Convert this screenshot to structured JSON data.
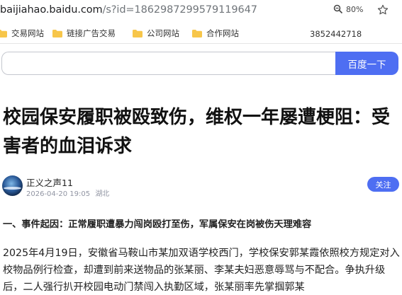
{
  "browser": {
    "url_host": "baijiahao.baidu.com",
    "url_path": "/s?id=1862987299579119647",
    "zoom": "80%"
  },
  "bookmarks": [
    {
      "label": "交易网站"
    },
    {
      "label": "链接广告交易"
    },
    {
      "label": "公司网站"
    },
    {
      "label": "合作网站"
    }
  ],
  "bookmark_extra": "3852442718",
  "search": {
    "button_label": "百度一下",
    "value": ""
  },
  "article": {
    "title": "校园保安履职被殴致伤，维权一年屡遭梗阻：受害者的血泪诉求",
    "author": "正义之声11",
    "date": "2026-04-20 19:05",
    "location": "湖北",
    "follow_label": "关注",
    "section_heading": "一、事件起因：正常履职遭暴力闯岗殴打至伤，军属保安在岗被伤天理难容",
    "body": "2025年4月19日，安徽省马鞍山市某加双语学校西门，学校保安郭某霞依照校方规定对入校物品例行检查，却遭到前来送物品的张某丽、李某夫妇恶意辱骂与不配合。争执升级后，二人强行扒开校园电动门禁闯入执勤区域，张某丽率先掌掴郭某"
  },
  "colors": {
    "accent": "#4e6ef2",
    "folder": "#f7c64a"
  }
}
